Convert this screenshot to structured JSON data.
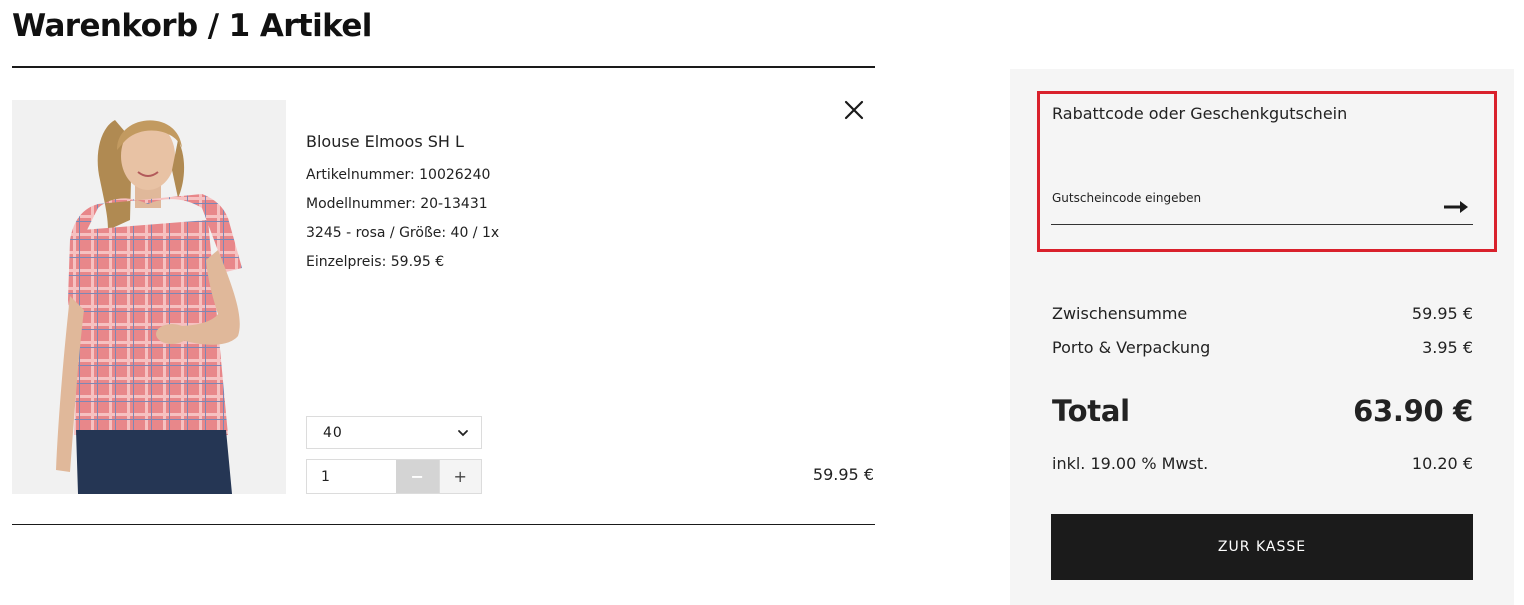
{
  "header": {
    "title": "Warenkorb / 1 Artikel"
  },
  "item": {
    "name": "Blouse Elmoos SH L",
    "article_number": "Artikelnummer: 10026240",
    "model_number": "Modellnummer: 20-13431",
    "variant": "3245 - rosa / Größe: 40 / 1x",
    "unit_price": "Einzelpreis: 59.95 €",
    "size_selected": "40",
    "quantity": "1",
    "minus_label": "−",
    "plus_label": "+",
    "line_total": "59.95 €",
    "remove_icon": "close-icon",
    "image_icon": "product-photo"
  },
  "coupon": {
    "title": "Rabattcode oder Geschenkgutschein",
    "placeholder": "Gutscheincode eingeben",
    "submit_icon": "arrow-right-icon",
    "highlight_color": "#d9212c"
  },
  "summary": {
    "subtotal_label": "Zwischensumme",
    "subtotal_value": "59.95 €",
    "shipping_label": "Porto & Verpackung",
    "shipping_value": "3.95 €",
    "total_label": "Total",
    "total_value": "63.90 €",
    "vat_label": "inkl. 19.00 % Mwst.",
    "vat_value": "10.20 €"
  },
  "checkout": {
    "label": "ZUR KASSE",
    "color": "#1b1b1b"
  }
}
